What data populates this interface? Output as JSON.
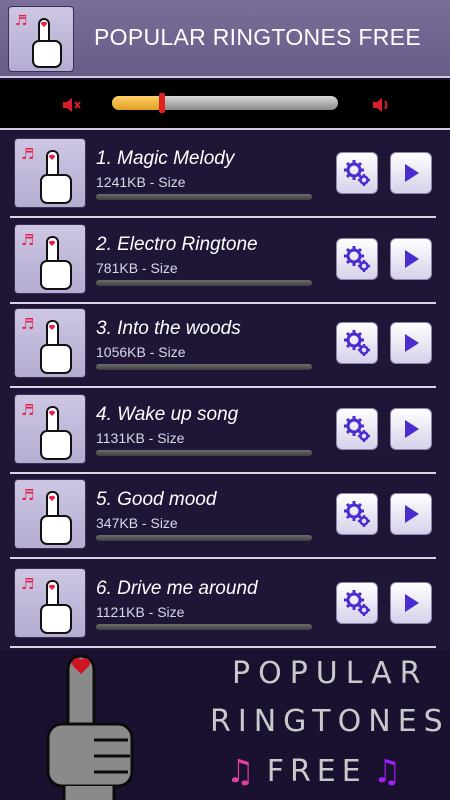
{
  "header": {
    "title": "POPULAR RINGTONES FREE"
  },
  "volume": {
    "level": 0.22
  },
  "ringtones": [
    {
      "name": "1. Magic Melody",
      "size": "1241KB - Size"
    },
    {
      "name": "2. Electro Ringtone",
      "size": "781KB - Size"
    },
    {
      "name": "3. Into the woods",
      "size": "1056KB - Size"
    },
    {
      "name": "4. Wake up song",
      "size": "1131KB - Size"
    },
    {
      "name": "5. Good mood",
      "size": "347KB - Size"
    },
    {
      "name": "6. Drive me around",
      "size": "1121KB - Size"
    }
  ],
  "banner": {
    "line1": "POPULAR",
    "line2": "RINGTONES",
    "line3": "FREE",
    "note_colors": [
      "#e040a0",
      "#a020f0"
    ]
  },
  "colors": {
    "header_bg": "#6f6391",
    "list_bg": "#1f1637",
    "note_red": "#e8204a",
    "button_icon": "#4a2ccf",
    "slider_fill": "#f0b43a",
    "slider_thumb": "#e22020"
  },
  "icons": {
    "thumb": "thumbs-up-heart-icon",
    "settings": "gears-icon",
    "play": "play-icon",
    "mute": "speaker-mute-icon",
    "loud": "speaker-loud-icon"
  }
}
